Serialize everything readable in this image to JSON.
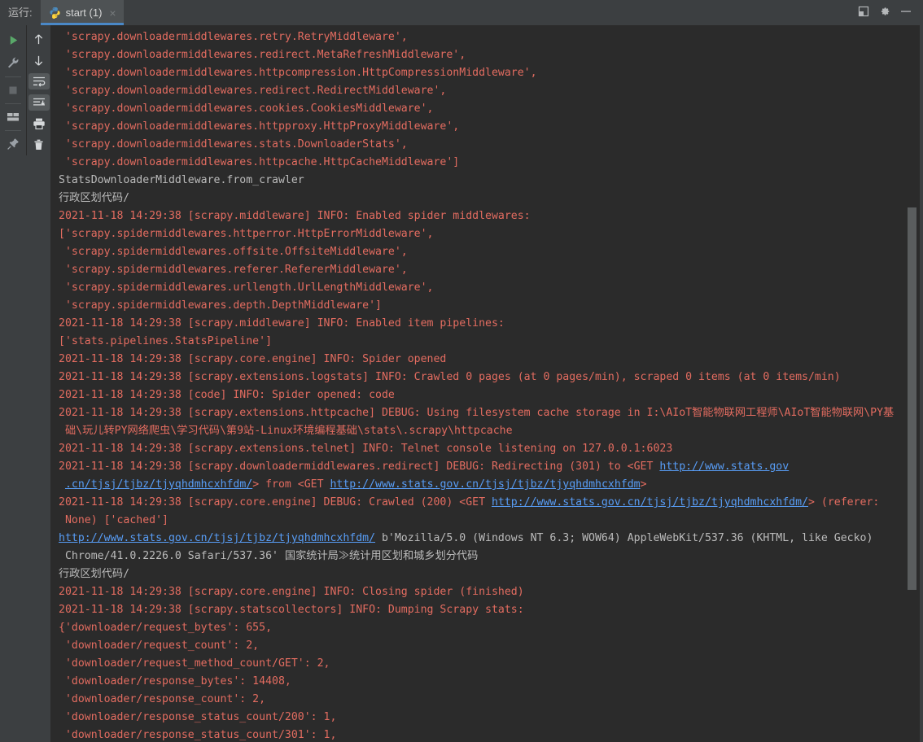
{
  "titlebar": {
    "run_label": "运行:",
    "tab": {
      "label": "start (1)",
      "close": "×",
      "icon": "python-icon"
    },
    "window_buttons": [
      {
        "name": "restore-panel-icon",
        "title": ""
      },
      {
        "name": "gear-icon",
        "title": ""
      },
      {
        "name": "minimize-icon",
        "title": ""
      }
    ]
  },
  "toolbar_left": [
    {
      "name": "rerun-button",
      "icon": "play-icon"
    },
    {
      "name": "edit-configurations-button",
      "icon": "wrench-icon"
    },
    {
      "name": "stop-button",
      "icon": "stop-square-icon"
    },
    {
      "name": "layout-button",
      "icon": "window-layout-icon"
    },
    {
      "name": "pin-tab-button",
      "icon": "pin-icon"
    }
  ],
  "toolbar_right": [
    {
      "name": "up-stack-trace-button",
      "icon": "arrow-up-icon"
    },
    {
      "name": "down-stack-trace-button",
      "icon": "arrow-down-icon"
    },
    {
      "name": "soft-wrap-button",
      "icon": "soft-wrap-icon"
    },
    {
      "name": "scroll-to-end-button",
      "icon": "scroll-end-icon"
    },
    {
      "name": "print-button",
      "icon": "printer-icon"
    },
    {
      "name": "clear-all-button",
      "icon": "trash-icon"
    }
  ],
  "colors": {
    "stderr": "#e36c60",
    "stdout": "#bbbbbb",
    "link": "#589df6",
    "console_bg": "#2b2b2b",
    "chrome_bg": "#3c3f41",
    "tab_active_bg": "#4e5254",
    "tab_underline": "#4a88c7"
  },
  "console": {
    "lines": [
      {
        "stream": "err",
        "text": " 'scrapy.downloadermiddlewares.retry.RetryMiddleware',"
      },
      {
        "stream": "err",
        "text": " 'scrapy.downloadermiddlewares.redirect.MetaRefreshMiddleware',"
      },
      {
        "stream": "err",
        "text": " 'scrapy.downloadermiddlewares.httpcompression.HttpCompressionMiddleware',"
      },
      {
        "stream": "err",
        "text": " 'scrapy.downloadermiddlewares.redirect.RedirectMiddleware',"
      },
      {
        "stream": "err",
        "text": " 'scrapy.downloadermiddlewares.cookies.CookiesMiddleware',"
      },
      {
        "stream": "err",
        "text": " 'scrapy.downloadermiddlewares.httpproxy.HttpProxyMiddleware',"
      },
      {
        "stream": "err",
        "text": " 'scrapy.downloadermiddlewares.stats.DownloaderStats',"
      },
      {
        "stream": "err",
        "text": " 'scrapy.downloadermiddlewares.httpcache.HttpCacheMiddleware']"
      },
      {
        "stream": "out",
        "text": "StatsDownloaderMiddleware.from_crawler"
      },
      {
        "stream": "out",
        "text": "行政区划代码/"
      },
      {
        "stream": "err",
        "text": "2021-11-18 14:29:38 [scrapy.middleware] INFO: Enabled spider middlewares:"
      },
      {
        "stream": "err",
        "text": "['scrapy.spidermiddlewares.httperror.HttpErrorMiddleware',"
      },
      {
        "stream": "err",
        "text": " 'scrapy.spidermiddlewares.offsite.OffsiteMiddleware',"
      },
      {
        "stream": "err",
        "text": " 'scrapy.spidermiddlewares.referer.RefererMiddleware',"
      },
      {
        "stream": "err",
        "text": " 'scrapy.spidermiddlewares.urllength.UrlLengthMiddleware',"
      },
      {
        "stream": "err",
        "text": " 'scrapy.spidermiddlewares.depth.DepthMiddleware']"
      },
      {
        "stream": "err",
        "text": "2021-11-18 14:29:38 [scrapy.middleware] INFO: Enabled item pipelines:"
      },
      {
        "stream": "err",
        "text": "['stats.pipelines.StatsPipeline']"
      },
      {
        "stream": "err",
        "text": "2021-11-18 14:29:38 [scrapy.core.engine] INFO: Spider opened"
      },
      {
        "stream": "err",
        "text": "2021-11-18 14:29:38 [scrapy.extensions.logstats] INFO: Crawled 0 pages (at 0 pages/min), scraped 0 items (at 0 items/min)"
      },
      {
        "stream": "err",
        "text": "2021-11-18 14:29:38 [code] INFO: Spider opened: code"
      },
      {
        "stream": "err",
        "text": "2021-11-18 14:29:38 [scrapy.extensions.httpcache] DEBUG: Using filesystem cache storage in I:\\AIoT智能物联网工程师\\AIoT智能物联网\\PY基"
      },
      {
        "stream": "err",
        "text": " 础\\玩儿转PY网络爬虫\\学习代码\\第9站-Linux环境编程基础\\stats\\.scrapy\\httpcache"
      },
      {
        "stream": "err",
        "text": "2021-11-18 14:29:38 [scrapy.extensions.telnet] INFO: Telnet console listening on 127.0.0.1:6023"
      },
      {
        "stream": "mixed",
        "segments": [
          {
            "kind": "err",
            "text": "2021-11-18 14:29:38 [scrapy.downloadermiddlewares.redirect] DEBUG: Redirecting (301) to <GET "
          },
          {
            "kind": "link",
            "text": "http://www.stats.gov"
          }
        ]
      },
      {
        "stream": "mixed",
        "segments": [
          {
            "kind": "err",
            "text": " "
          },
          {
            "kind": "link",
            "text": ".cn/tjsj/tjbz/tjyqhdmhcxhfdm/"
          },
          {
            "kind": "err",
            "text": "> from <GET "
          },
          {
            "kind": "link",
            "text": "http://www.stats.gov.cn/tjsj/tjbz/tjyqhdmhcxhfdm"
          },
          {
            "kind": "err",
            "text": ">"
          }
        ]
      },
      {
        "stream": "mixed",
        "segments": [
          {
            "kind": "err",
            "text": "2021-11-18 14:29:38 [scrapy.core.engine] DEBUG: Crawled (200) <GET "
          },
          {
            "kind": "link",
            "text": "http://www.stats.gov.cn/tjsj/tjbz/tjyqhdmhcxhfdm/"
          },
          {
            "kind": "err",
            "text": "> (referer:"
          }
        ]
      },
      {
        "stream": "err",
        "text": " None) ['cached']"
      },
      {
        "stream": "mixed",
        "segments": [
          {
            "kind": "link",
            "text": "http://www.stats.gov.cn/tjsj/tjbz/tjyqhdmhcxhfdm/"
          },
          {
            "kind": "out",
            "text": " b'Mozilla/5.0 (Windows NT 6.3; WOW64) AppleWebKit/537.36 (KHTML, like Gecko)"
          }
        ]
      },
      {
        "stream": "out",
        "text": " Chrome/41.0.2226.0 Safari/537.36' 国家统计局≫统计用区划和城乡划分代码"
      },
      {
        "stream": "out",
        "text": "行政区划代码/"
      },
      {
        "stream": "err",
        "text": "2021-11-18 14:29:38 [scrapy.core.engine] INFO: Closing spider (finished)"
      },
      {
        "stream": "err",
        "text": "2021-11-18 14:29:38 [scrapy.statscollectors] INFO: Dumping Scrapy stats:"
      },
      {
        "stream": "err",
        "text": "{'downloader/request_bytes': 655,"
      },
      {
        "stream": "err",
        "text": " 'downloader/request_count': 2,"
      },
      {
        "stream": "err",
        "text": " 'downloader/request_method_count/GET': 2,"
      },
      {
        "stream": "err",
        "text": " 'downloader/response_bytes': 14408,"
      },
      {
        "stream": "err",
        "text": " 'downloader/response_count': 2,"
      },
      {
        "stream": "err",
        "text": " 'downloader/response_status_count/200': 1,"
      },
      {
        "stream": "err",
        "text": " 'downloader/response_status_count/301': 1,"
      }
    ]
  },
  "scrollbar": {
    "name": "console-vertical-scrollbar"
  }
}
